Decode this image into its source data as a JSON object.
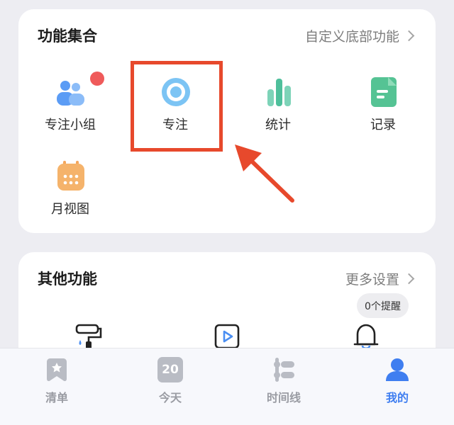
{
  "feature_section": {
    "title": "功能集合",
    "customize_link": "自定义底部功能",
    "items": [
      {
        "label": "专注小组",
        "icon": "group-icon",
        "has_badge": true
      },
      {
        "label": "专注",
        "icon": "focus-icon",
        "highlighted": true
      },
      {
        "label": "统计",
        "icon": "stats-icon"
      },
      {
        "label": "记录",
        "icon": "record-icon"
      },
      {
        "label": "月视图",
        "icon": "calendar-icon"
      }
    ]
  },
  "other_section": {
    "title": "其他功能",
    "more_link": "更多设置",
    "reminder_tooltip": "0个提醒",
    "items": [
      {
        "icon": "paint-roller-icon"
      },
      {
        "icon": "video-play-icon"
      },
      {
        "icon": "bell-icon"
      }
    ]
  },
  "tabbar": {
    "tabs": [
      {
        "label": "清单",
        "icon": "checklist-icon"
      },
      {
        "label": "今天",
        "icon": "calendar-day-icon",
        "day_number": "20"
      },
      {
        "label": "时间线",
        "icon": "timeline-icon"
      },
      {
        "label": "我的",
        "icon": "profile-icon",
        "active": true
      }
    ]
  },
  "colors": {
    "accent": "#3f7ef0",
    "highlight_box": "#e7492c",
    "background": "#ededf2"
  }
}
